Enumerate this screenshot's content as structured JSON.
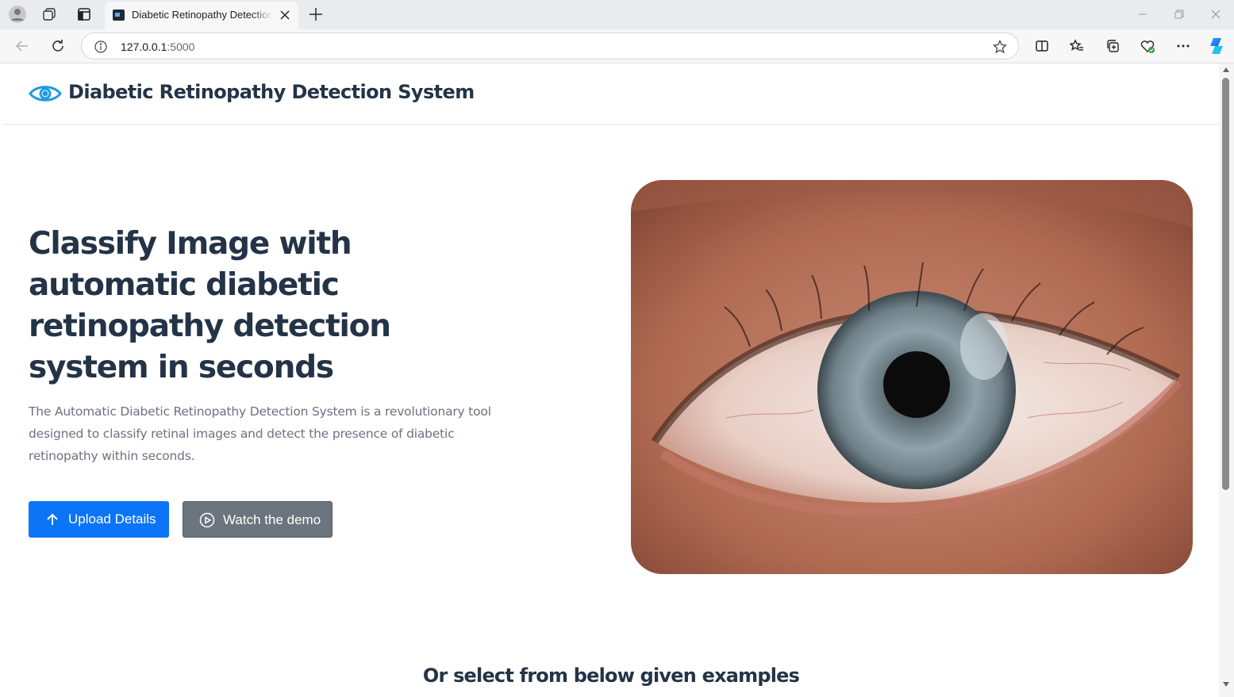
{
  "browser": {
    "tab_title": "Diabetic Retinopathy Detection System",
    "url_host": "127.0.0.1",
    "url_port": ":5000",
    "icons": [
      "profile-icon",
      "workspaces-icon",
      "vertical-tabs-icon",
      "tab-close-icon",
      "new-tab-icon",
      "minimize-icon",
      "restore-icon",
      "window-close-icon",
      "back-icon",
      "refresh-icon",
      "site-info-icon",
      "favorite-star-icon",
      "split-screen-icon",
      "favorites-icon",
      "collections-icon",
      "browser-essentials-icon",
      "more-icon",
      "copilot-icon"
    ]
  },
  "navbar": {
    "brand": "Diabetic Retinopathy Detection System",
    "logo_icon": "eye-icon"
  },
  "hero": {
    "title": "Classify Image with automatic diabetic retinopathy detection system in seconds",
    "description": "The Automatic Diabetic Retinopathy Detection System is a revolutionary tool designed to classify retinal images and detect the presence of diabetic retinopathy within seconds.",
    "upload_button": "Upload Details",
    "demo_button": "Watch the demo",
    "image": "close-up-eye-photo"
  },
  "examples": {
    "heading": "Or select from below given examples"
  },
  "colors": {
    "primary": "#0b74f7",
    "secondary": "#6c757d",
    "heading": "#243447",
    "text_muted": "#6b7280",
    "logo": "#1e9be0"
  }
}
